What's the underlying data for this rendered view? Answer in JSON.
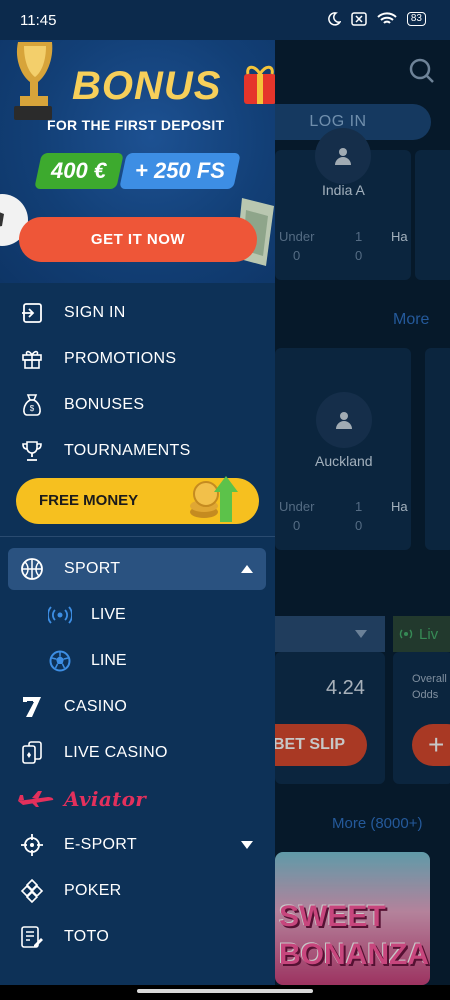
{
  "status_bar": {
    "time": "11:45",
    "battery": "83"
  },
  "background": {
    "login_label": "LOG IN",
    "team_top": "India A",
    "under_label_1": "Under",
    "under_val_1": "0",
    "mid_val_1a": "1",
    "mid_val_1b": "0",
    "ha_label_1": "Ha",
    "more_label": "More",
    "team_mid": "Auckland",
    "under_label_2": "Under",
    "under_val_2": "0",
    "mid_val_2a": "1",
    "mid_val_2b": "0",
    "ha_label_2": "Ha",
    "live_label": "Liv",
    "odds_value": "4.24",
    "overall_label": "Overall",
    "odds_label": "Odds",
    "bet_slip_label": "BET SLIP",
    "plus_label": "+",
    "more_count_label": "More (8000+)",
    "game_title": "SWEET BONANZA"
  },
  "banner": {
    "title": "BONUS",
    "subtitle": "FOR THE FIRST DEPOSIT",
    "chip_money": "400 €",
    "chip_fs": "+ 250 FS",
    "cta": "GET IT NOW"
  },
  "menu": {
    "sign_in": "SIGN IN",
    "promotions": "PROMOTIONS",
    "bonuses": "BONUSES",
    "tournaments": "TOURNAMENTS",
    "free_money": "FREE MONEY",
    "sport": "SPORT",
    "live": "LIVE",
    "line": "LINE",
    "casino": "CASINO",
    "live_casino": "LIVE CASINO",
    "aviator": "Aviator",
    "esport": "E-SPORT",
    "poker": "POKER",
    "toto": "TOTO"
  },
  "colors": {
    "drawer_bg": "#0d3157",
    "accent_orange": "#ee5638",
    "accent_yellow": "#f6c01f",
    "active_item_bg": "#2a5280",
    "sub_icon_blue": "#3d8ee4"
  }
}
